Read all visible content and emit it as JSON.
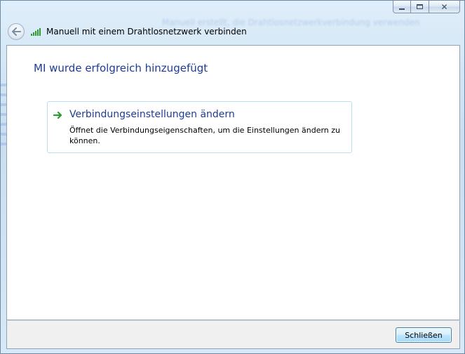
{
  "window": {
    "caption_buttons": {
      "minimize_icon": "minimize-icon",
      "maximize_icon": "maximize-icon",
      "close_glyph": "✕"
    }
  },
  "background_hint": "Manuell erstellt, die Drahtlosnetzwerkverbindung verwenden",
  "header": {
    "back_icon": "back-arrow-icon",
    "network_icon": "wireless-signal-icon",
    "title": "Manuell mit einem Drahtlosnetzwerk verbinden"
  },
  "main": {
    "heading": "MI wurde erfolgreich hinzugefügt",
    "option": {
      "icon": "green-arrow-icon",
      "title": "Verbindungseinstellungen ändern",
      "description": "Öffnet die Verbindungseigenschaften, um die Einstellungen ändern zu können."
    }
  },
  "footer": {
    "close_label": "Schließen"
  },
  "colors": {
    "heading_blue": "#1e3c96",
    "signal_green": "#2f9a2f",
    "option_border": "#b8dff0",
    "button_border": "#3c7fb1"
  }
}
